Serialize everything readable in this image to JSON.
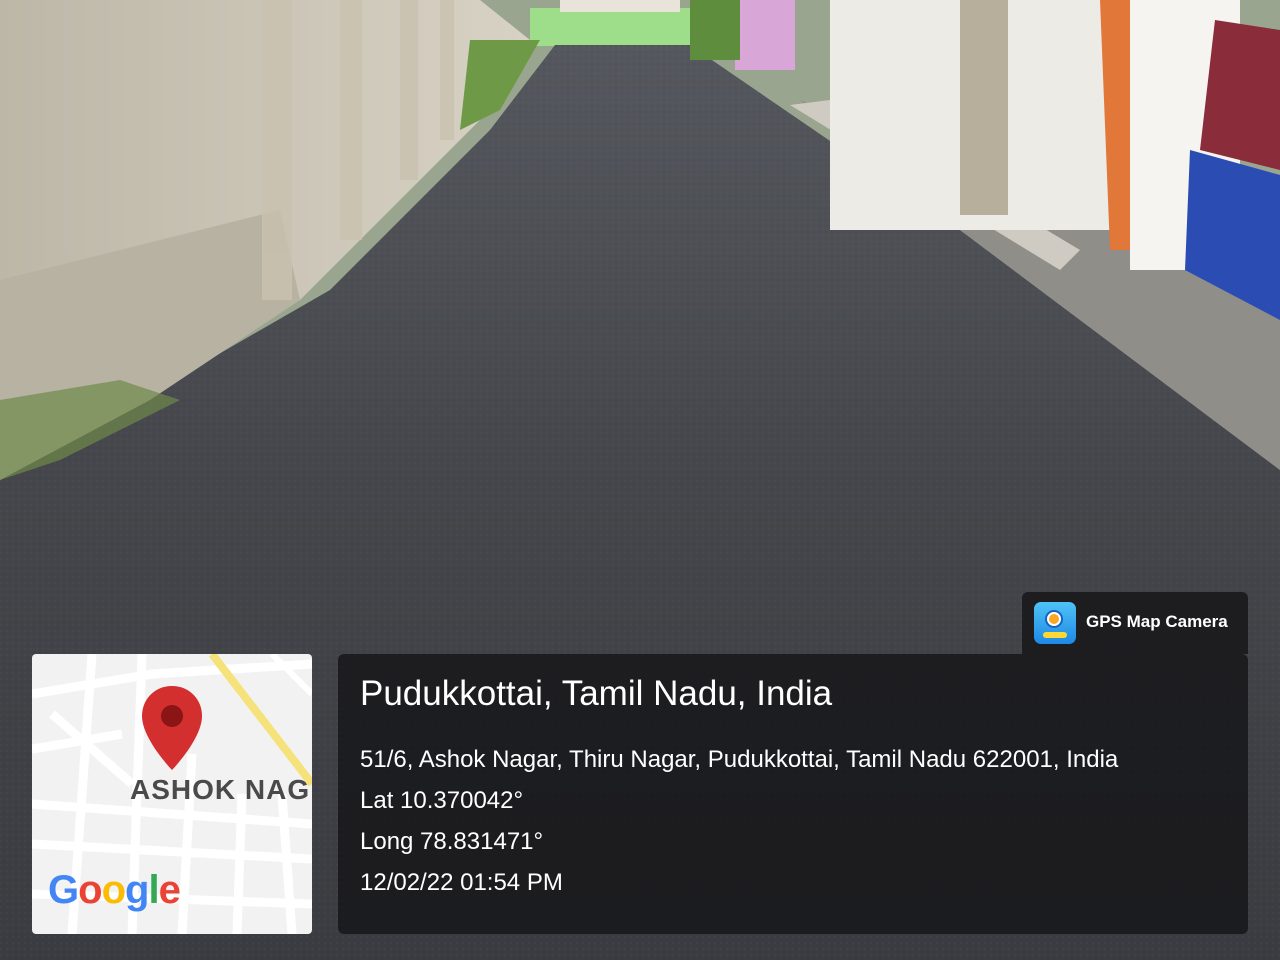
{
  "photo": {
    "subject": "freshly paved asphalt lane between compound walls",
    "colors": {
      "asphalt": "#3d3f44",
      "wall": "#cfcabd",
      "gate": "#2b4db3",
      "sky_hedge": "#7cbf5a"
    }
  },
  "map_thumbnail": {
    "area_label": "ASHOK NAG",
    "brand": "Google",
    "pin_icon": "map-pin-icon",
    "pin_color": "#d32f2f"
  },
  "badge": {
    "app_name": "GPS Map Camera",
    "icon": "gps-camera-app-icon"
  },
  "location": {
    "title": "Pudukkottai, Tamil Nadu, India",
    "address": "51/6, Ashok Nagar, Thiru Nagar, Pudukkottai, Tamil Nadu 622001, India",
    "lat": "Lat 10.370042°",
    "long": "Long 78.831471°",
    "datetime": "12/02/22 01:54 PM"
  }
}
